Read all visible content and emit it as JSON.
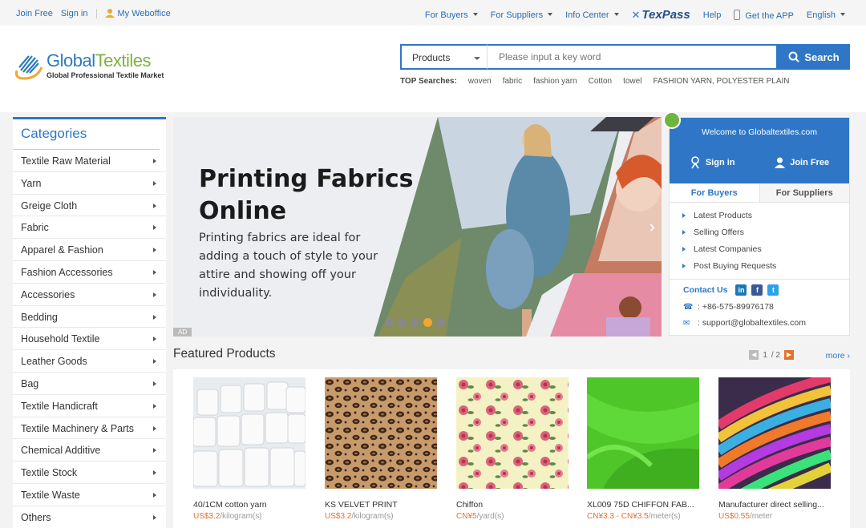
{
  "topbar": {
    "join_free": "Join Free",
    "sign_in": "Sign in",
    "my_weboffice": "My Weboffice",
    "for_buyers": "For Buyers",
    "for_suppliers": "For Suppliers",
    "info_center": "Info Center",
    "texpass": "TexPass",
    "help": "Help",
    "get_app": "Get the APP",
    "language": "English"
  },
  "logo": {
    "name_part1": "Global",
    "name_part2": "Textiles",
    "tagline": "Global Professional Textile Market"
  },
  "search": {
    "type": "Products",
    "placeholder": "Please input a key word",
    "button": "Search",
    "top_label": "TOP Searches:",
    "terms": [
      "woven",
      "fabric",
      "fashion yarn",
      "Cotton",
      "towel",
      "FASHION YARN, POLYESTER PLAIN"
    ]
  },
  "categories": {
    "title": "Categories",
    "items": [
      "Textile Raw Material",
      "Yarn",
      "Greige Cloth",
      "Fabric",
      "Apparel & Fashion",
      "Fashion Accessories",
      "Accessories",
      "Bedding",
      "Household Textile",
      "Leather Goods",
      "Bag",
      "Textile Handicraft",
      "Textile Machinery & Parts",
      "Chemical Additive",
      "Textile Stock",
      "Textile Waste",
      "Others"
    ]
  },
  "banner": {
    "title": "Printing Fabrics Online",
    "text": "Printing fabrics are ideal for adding a touch of style to your attire and showing off your individuality.",
    "ad": "AD",
    "active_dot": 4,
    "dots": 5
  },
  "welcome": {
    "title": "Welcome to Globaltextiles.com",
    "sign_in": "Sign in",
    "join_free": "Join Free",
    "tab_buyers": "For Buyers",
    "tab_suppliers": "For Suppliers",
    "links": [
      "Latest Products",
      "Selling Offers",
      "Latest Companies",
      "Post Buying Requests"
    ],
    "contact_label": "Contact Us",
    "phone": ": +86-575-89976178",
    "email": ": support@globaltextiles.com"
  },
  "featured": {
    "title": "Featured Products",
    "page": "1",
    "pages": "/ 2",
    "more": "more",
    "products": [
      {
        "name": "40/1CM cotton yarn",
        "price": "US$3.2",
        "unit": "/kilogram(s)"
      },
      {
        "name": "KS VELVET PRINT",
        "price": "US$3.2",
        "unit": "/kilogram(s)"
      },
      {
        "name": "Chiffon",
        "price": "CN¥5",
        "unit": "/yard(s)"
      },
      {
        "name": "XL009 75D CHIFFON FAB...",
        "price": "CN¥3.3 - CN¥3.5",
        "unit": "/meter(s)"
      },
      {
        "name": "Manufacturer direct selling...",
        "price": "US$0.55",
        "unit": "/meter"
      }
    ]
  },
  "colors": {
    "brand_blue": "#2f77c6",
    "brand_green": "#7db142",
    "price_orange": "#e4712b"
  }
}
